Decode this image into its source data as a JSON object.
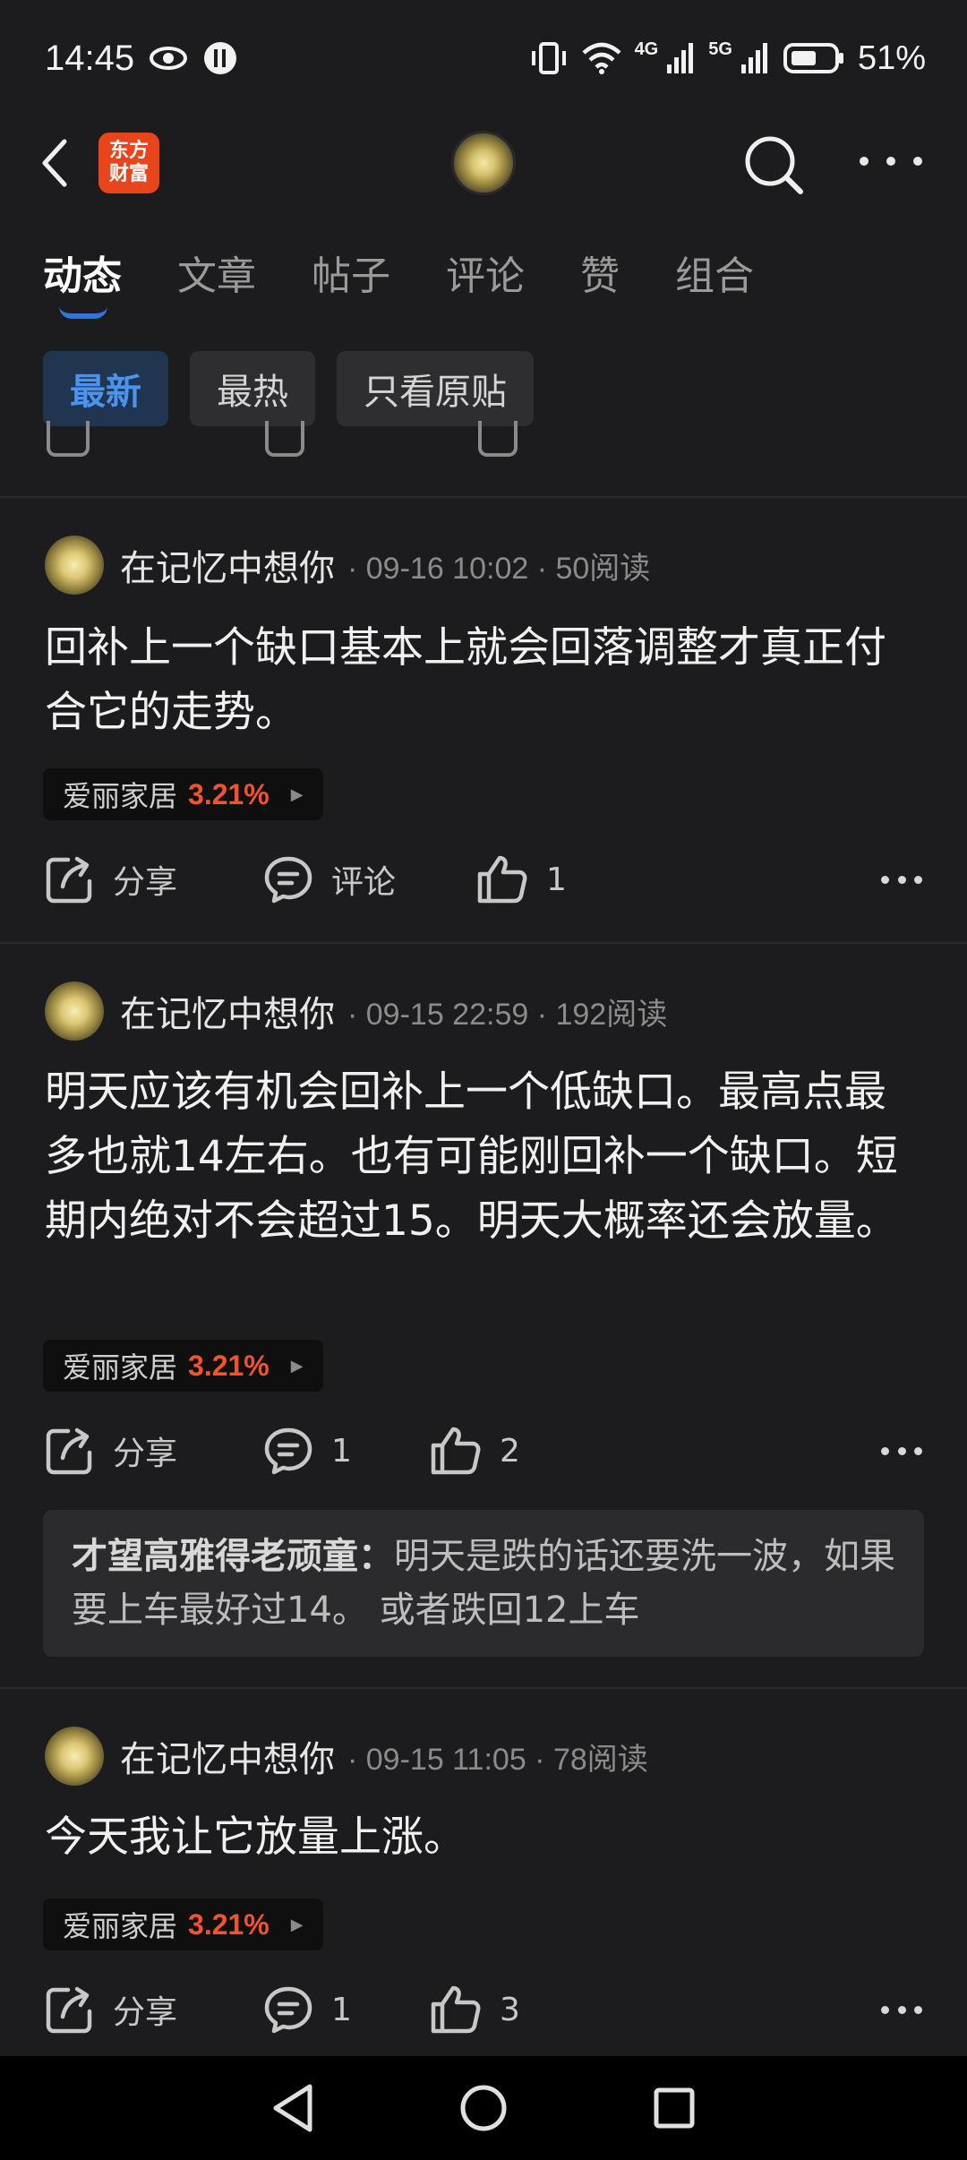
{
  "status": {
    "time": "14:45",
    "net1": "4G",
    "net2": "5G",
    "battery": "51%"
  },
  "header": {
    "logo_line1": "东方",
    "logo_line2": "财富"
  },
  "tabs": [
    "动态",
    "文章",
    "帖子",
    "评论",
    "赞",
    "组合"
  ],
  "filters": [
    "最新",
    "最热",
    "只看原贴"
  ],
  "posts": [
    {
      "author": "在记忆中想你",
      "meta": "· 09-16 10:02 · 50阅读",
      "text": "回补上一个缺口基本上就会回落调整才真正付合它的走势。",
      "stock": "爱丽家居",
      "pct": "3.21%",
      "share": "分享",
      "comment": "评论",
      "likes": "1"
    },
    {
      "author": "在记忆中想你",
      "meta": "· 09-15 22:59 · 192阅读",
      "text": "明天应该有机会回补上一个低缺口。最高点最多也就14左右。也有可能刚回补一个缺口。短期内绝对不会超过15。明天大概率还会放量。",
      "stock": "爱丽家居",
      "pct": "3.21%",
      "share": "分享",
      "comment": "1",
      "likes": "2",
      "reply_user": "才望高雅得老顽童：",
      "reply_text": "明天是跌的话还要洗一波，如果要上车最好过14。 或者跌回12上车"
    },
    {
      "author": "在记忆中想你",
      "meta": "· 09-15 11:05 · 78阅读",
      "text": "今天我让它放量上涨。",
      "stock": "爱丽家居",
      "pct": "3.21%",
      "share": "分享",
      "comment": "1",
      "likes": "3"
    }
  ],
  "icons": {
    "eye": "eye-icon",
    "vibrate": "vibrate-icon",
    "wifi": "wifi-icon",
    "signal": "signal-icon",
    "battery": "battery-icon",
    "back": "back-icon",
    "search": "search-icon",
    "more": "more-icon",
    "share": "share-icon",
    "comment": "comment-icon",
    "like": "like-icon"
  },
  "colors": {
    "accent": "#2f76d8",
    "stock_up": "#f2532f",
    "background": "#1c1c1e",
    "logo": "#e8451d"
  }
}
